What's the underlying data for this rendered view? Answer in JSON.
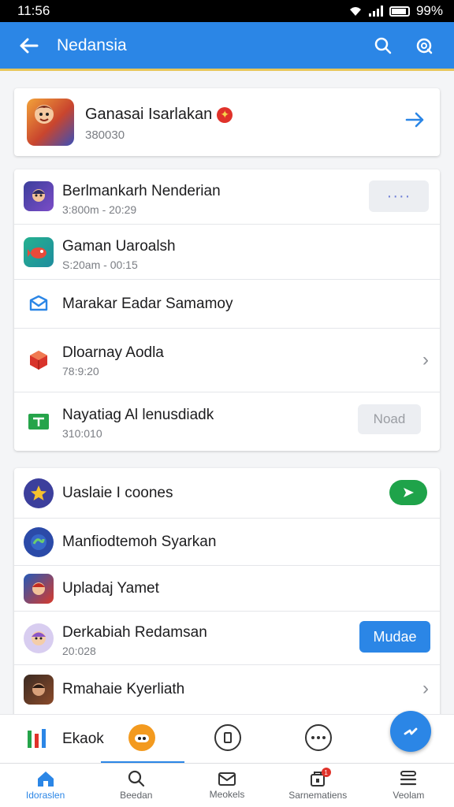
{
  "status": {
    "time": "11:56",
    "battery": "99%"
  },
  "header": {
    "title": "Nedansia",
    "icons": [
      "back-arrow-icon",
      "search-icon",
      "search-alt-icon"
    ]
  },
  "featured": {
    "title": "Ganasai Isarlakan",
    "subtitle": "380030",
    "badge_icon": "red-badge-icon",
    "action_icon": "arrow-right-icon"
  },
  "list1": [
    {
      "title": "Berlmankarh Nenderian",
      "subtitle": "3:800m - 20:29",
      "action": "····"
    },
    {
      "title": "Gaman Uaroalsh",
      "subtitle": "S:20am - 00:15"
    },
    {
      "title": "Marakar Eadar Samamoy"
    },
    {
      "title": "Dloarnay Aodla",
      "subtitle": "78:9:20"
    },
    {
      "title": "Nayatiag Al lenusdiadk",
      "subtitle": "310:010",
      "action": "Noad"
    }
  ],
  "list2": [
    {
      "title": "Uaslaie I coones"
    },
    {
      "title": "Manfiodtemoh Syarkan"
    },
    {
      "title": "Upladaj Yamet"
    },
    {
      "title": "Derkabiah Redamsan",
      "subtitle": "20:028",
      "action": "Mudae"
    },
    {
      "title": "Rmahaie Kyerliath"
    },
    {
      "title": "Ekaok"
    }
  ],
  "bottom_nav": [
    {
      "label": "Idoraslen",
      "icon": "home-icon",
      "active": true
    },
    {
      "label": "Beedan",
      "icon": "search-icon",
      "active": false
    },
    {
      "label": "Meokels",
      "icon": "mail-icon",
      "active": false
    },
    {
      "label": "Sarnematiens",
      "icon": "notification-icon",
      "active": false,
      "badge": "1"
    },
    {
      "label": "Veolam",
      "icon": "menu-icon",
      "active": false
    }
  ],
  "colors": {
    "accent": "#2b86e6",
    "green": "#1fa34a",
    "header_border": "#e8c65a"
  }
}
